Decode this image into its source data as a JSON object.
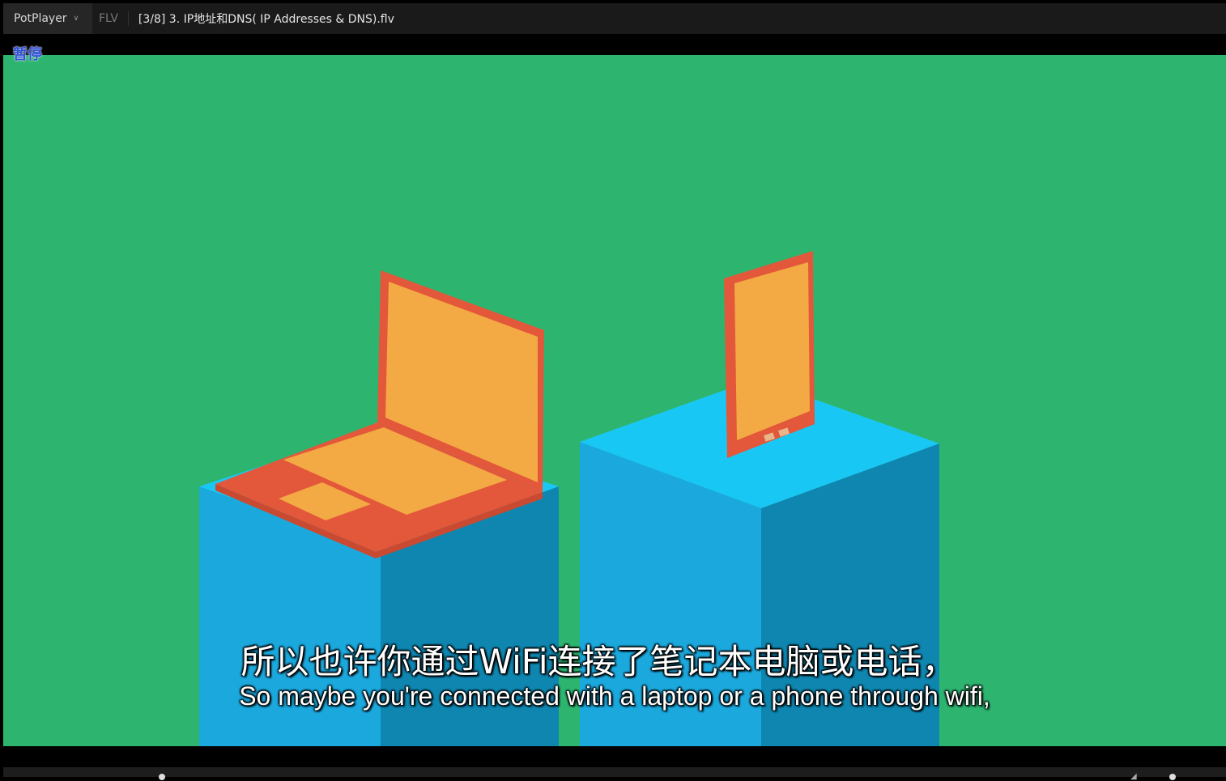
{
  "titlebar": {
    "app_name": "PotPlayer",
    "format": "FLV",
    "filename": "[3/8] 3. IP地址和DNS( IP Addresses & DNS).flv"
  },
  "osd": {
    "status": "暂停"
  },
  "subtitles": {
    "chinese": "所以也许你通过WiFi连接了笔记本电脑或电话，",
    "english": "So maybe you're connected with a laptop or a phone through wifi,"
  },
  "colors": {
    "background": "#2db570",
    "pillar_light": "#1ba8dd",
    "pillar_dark": "#0f86b0",
    "pillar_top": "#19c7f5",
    "device_frame": "#e3573a",
    "device_screen": "#f3a944"
  },
  "icons": {
    "menu_chevron": "chevron-down-icon",
    "volume": "speaker-icon"
  }
}
